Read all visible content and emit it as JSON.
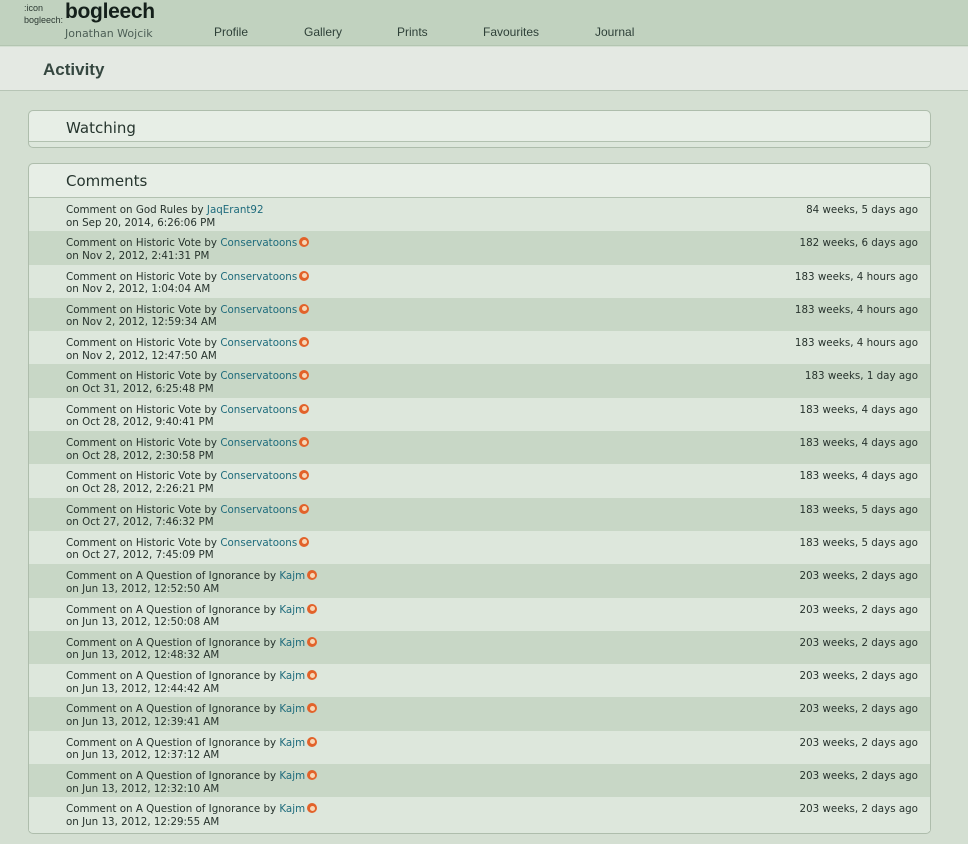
{
  "header": {
    "avatar_alt": ":icon bogleech:",
    "username": "bogleech",
    "real_name": "Jonathan Wojcik",
    "nav": [
      "Profile",
      "Gallery",
      "Prints",
      "Favourites",
      "Journal"
    ]
  },
  "activity": {
    "title": "Activity"
  },
  "watching": {
    "title": "Watching"
  },
  "comments": {
    "title": "Comments",
    "prefix": "Comment on",
    "by": "by",
    "on": "on",
    "items": [
      {
        "deviation": "God Rules",
        "user": "JaqErant92",
        "badge": false,
        "date": "Sep 20, 2014, 6:26:06 PM",
        "ago": "84 weeks, 5 days ago"
      },
      {
        "deviation": "Historic Vote",
        "user": "Conservatoons",
        "badge": true,
        "date": "Nov 2, 2012, 2:41:31 PM",
        "ago": "182 weeks, 6 days ago"
      },
      {
        "deviation": "Historic Vote",
        "user": "Conservatoons",
        "badge": true,
        "date": "Nov 2, 2012, 1:04:04 AM",
        "ago": "183 weeks, 4 hours ago"
      },
      {
        "deviation": "Historic Vote",
        "user": "Conservatoons",
        "badge": true,
        "date": "Nov 2, 2012, 12:59:34 AM",
        "ago": "183 weeks, 4 hours ago"
      },
      {
        "deviation": "Historic Vote",
        "user": "Conservatoons",
        "badge": true,
        "date": "Nov 2, 2012, 12:47:50 AM",
        "ago": "183 weeks, 4 hours ago"
      },
      {
        "deviation": "Historic Vote",
        "user": "Conservatoons",
        "badge": true,
        "date": "Oct 31, 2012, 6:25:48 PM",
        "ago": "183 weeks, 1 day ago"
      },
      {
        "deviation": "Historic Vote",
        "user": "Conservatoons",
        "badge": true,
        "date": "Oct 28, 2012, 9:40:41 PM",
        "ago": "183 weeks, 4 days ago"
      },
      {
        "deviation": "Historic Vote",
        "user": "Conservatoons",
        "badge": true,
        "date": "Oct 28, 2012, 2:30:58 PM",
        "ago": "183 weeks, 4 days ago"
      },
      {
        "deviation": "Historic Vote",
        "user": "Conservatoons",
        "badge": true,
        "date": "Oct 28, 2012, 2:26:21 PM",
        "ago": "183 weeks, 4 days ago"
      },
      {
        "deviation": "Historic Vote",
        "user": "Conservatoons",
        "badge": true,
        "date": "Oct 27, 2012, 7:46:32 PM",
        "ago": "183 weeks, 5 days ago"
      },
      {
        "deviation": "Historic Vote",
        "user": "Conservatoons",
        "badge": true,
        "date": "Oct 27, 2012, 7:45:09 PM",
        "ago": "183 weeks, 5 days ago"
      },
      {
        "deviation": "A Question of Ignorance",
        "user": "Kajm",
        "badge": true,
        "date": "Jun 13, 2012, 12:52:50 AM",
        "ago": "203 weeks, 2 days ago"
      },
      {
        "deviation": "A Question of Ignorance",
        "user": "Kajm",
        "badge": true,
        "date": "Jun 13, 2012, 12:50:08 AM",
        "ago": "203 weeks, 2 days ago"
      },
      {
        "deviation": "A Question of Ignorance",
        "user": "Kajm",
        "badge": true,
        "date": "Jun 13, 2012, 12:48:32 AM",
        "ago": "203 weeks, 2 days ago"
      },
      {
        "deviation": "A Question of Ignorance",
        "user": "Kajm",
        "badge": true,
        "date": "Jun 13, 2012, 12:44:42 AM",
        "ago": "203 weeks, 2 days ago"
      },
      {
        "deviation": "A Question of Ignorance",
        "user": "Kajm",
        "badge": true,
        "date": "Jun 13, 2012, 12:39:41 AM",
        "ago": "203 weeks, 2 days ago"
      },
      {
        "deviation": "A Question of Ignorance",
        "user": "Kajm",
        "badge": true,
        "date": "Jun 13, 2012, 12:37:12 AM",
        "ago": "203 weeks, 2 days ago"
      },
      {
        "deviation": "A Question of Ignorance",
        "user": "Kajm",
        "badge": true,
        "date": "Jun 13, 2012, 12:32:10 AM",
        "ago": "203 weeks, 2 days ago"
      },
      {
        "deviation": "A Question of Ignorance",
        "user": "Kajm",
        "badge": true,
        "date": "Jun 13, 2012, 12:29:55 AM",
        "ago": "203 weeks, 2 days ago"
      }
    ]
  },
  "colors": {
    "topbar": "#c1d2bf",
    "background": "#d4dfd2",
    "row_even": "#c8d7c6",
    "row_odd": "#dde7dc",
    "link": "#1e6b7c",
    "badge": "#e2622a"
  }
}
